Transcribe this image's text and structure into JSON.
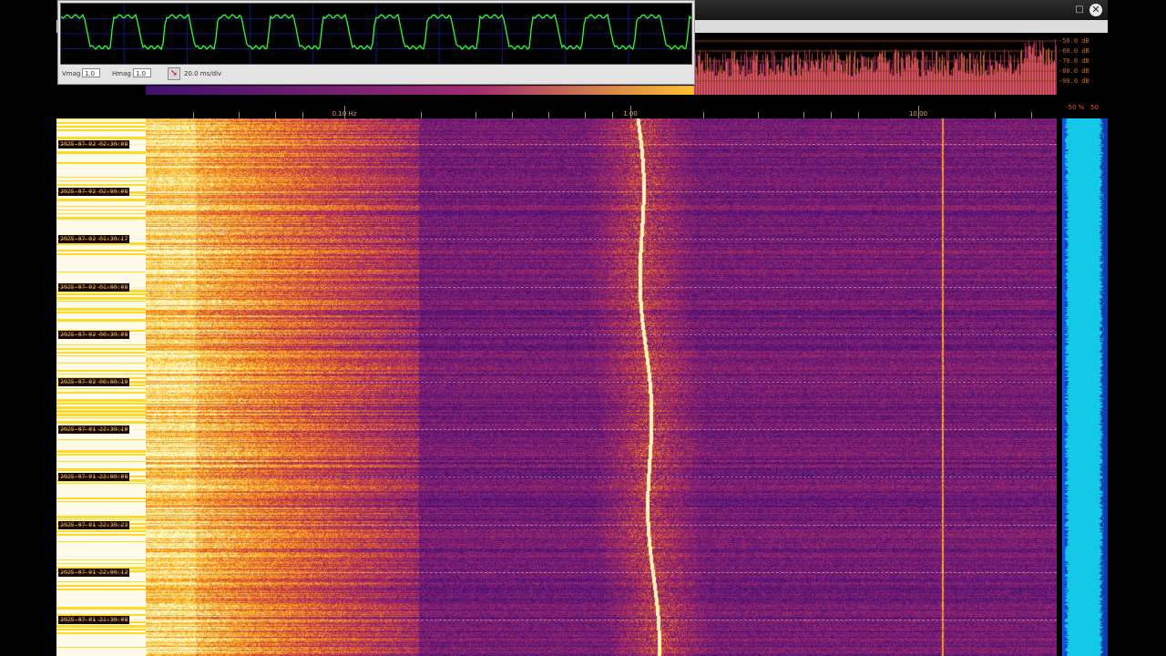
{
  "window": {
    "maximize_glyph": "□",
    "close_glyph": "✕"
  },
  "spectrum": {
    "db_scale": [
      "-50.0 dB",
      "-60.0 dB",
      "-70.0 dB",
      "-80.0 dB",
      "-90.0 dB"
    ]
  },
  "frequency_axis": {
    "labels": [
      "0.10 Hz",
      "1.00",
      "10.00"
    ],
    "percent_label": "-50 %",
    "percent_max": "50"
  },
  "waterfall": {
    "timestamps": [
      "2025-07-02 02:30:08",
      "2025-07-02 02:00:08",
      "2025-07-02 01:30:17",
      "2025-07-02 01:00:08",
      "2025-07-02 00:30:08",
      "2025-07-02 00:00:19",
      "2025-07-01 23:30:10",
      "2025-07-01 23:00:08",
      "2025-07-01 22:30:23",
      "2025-07-01 22:00:12",
      "2025-07-01 21:30:08"
    ]
  },
  "scope": {
    "vmag_label": "Vmag",
    "vmag_value": "1.0",
    "hmag_label": "Hmag",
    "hmag_value": "1.0",
    "timebase": "20.0 ms/div",
    "probe_icon": "probe-arrow-icon",
    "trace_color": "#2cff2c"
  },
  "colors": {
    "waterfall_bg": "#2a0f55",
    "hot": "#ffd92a",
    "cyan": "#14c8e8"
  }
}
